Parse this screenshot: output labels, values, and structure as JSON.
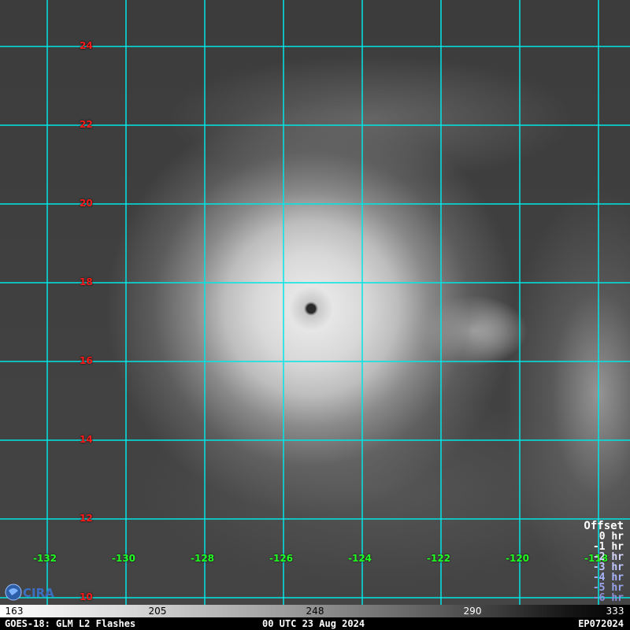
{
  "lat_labels": [
    "24",
    "22",
    "20",
    "18",
    "16",
    "14",
    "12",
    "10"
  ],
  "lon_labels": [
    "-132",
    "-130",
    "-128",
    "-126",
    "-124",
    "-122",
    "-120",
    "-118"
  ],
  "legend": {
    "title": "Offset",
    "items": [
      {
        "label": "0 hr",
        "color": "#ffffff"
      },
      {
        "label": "-1 hr",
        "color": "#ffffff"
      },
      {
        "label": "-2 hr",
        "color": "#d8d8ff"
      },
      {
        "label": "-3 hr",
        "color": "#c0c8ff"
      },
      {
        "label": "-4 hr",
        "color": "#a8b4ff"
      },
      {
        "label": "-5 hr",
        "color": "#9aa4ee"
      },
      {
        "label": "-6 hr",
        "color": "#8e8edc"
      }
    ]
  },
  "colorbar": {
    "ticks": [
      "163",
      "205",
      "248",
      "290",
      "333"
    ]
  },
  "footer": {
    "left": "GOES-18: GLM L2 Flashes",
    "center": "00 UTC 23 Aug 2024",
    "right": "EP072024"
  },
  "colors": {
    "grid": "#00e5e5",
    "lat_label": "#ff1a1a",
    "lon_label": "#22ff22",
    "eye": "#2a2a2a"
  }
}
